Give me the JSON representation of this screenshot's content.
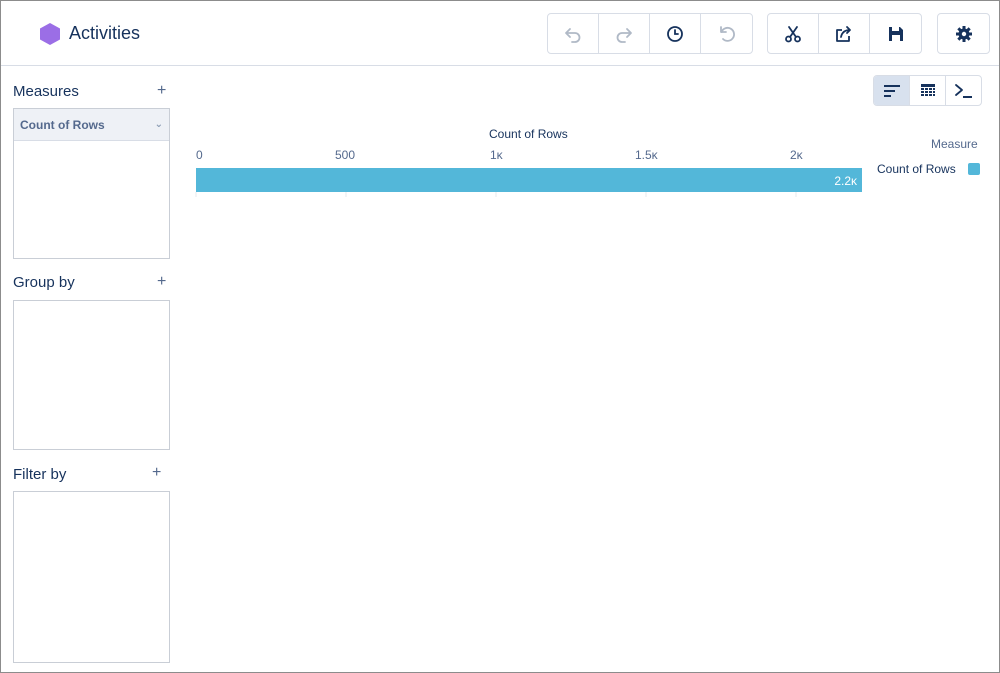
{
  "header": {
    "title": "Activities",
    "app_icon": "hexagon-icon",
    "app_icon_color": "#9b6ee6"
  },
  "toolbar": {
    "history_group": [
      "undo-icon",
      "redo-icon",
      "history-clock-icon",
      "reset-icon"
    ],
    "action_group": [
      "scissors-icon",
      "share-icon",
      "save-icon"
    ],
    "settings_group": [
      "gear-icon"
    ]
  },
  "sidebar": {
    "measures": {
      "title": "Measures",
      "add_label": "+",
      "items": [
        {
          "label": "Count of Rows"
        }
      ]
    },
    "group_by": {
      "title": "Group by",
      "add_label": "+"
    },
    "filter_by": {
      "title": "Filter by",
      "add_label": "+"
    }
  },
  "view_toggle": {
    "items": [
      "bar-chart-icon",
      "table-icon",
      "query-console-icon"
    ],
    "active": "bar-chart-icon"
  },
  "colors": {
    "bar": "#53b7d9",
    "text": "#16325c",
    "muted": "#54698d",
    "border": "#d8dde6"
  },
  "chart_data": {
    "type": "bar",
    "orientation": "horizontal",
    "title": "",
    "xlabel": "Count of Rows",
    "xlim": [
      0,
      2220
    ],
    "x_ticks": [
      "0",
      "500",
      "1κ",
      "1.5κ",
      "2κ"
    ],
    "x_tick_values": [
      0,
      500,
      1000,
      1500,
      2000
    ],
    "categories": [
      ""
    ],
    "series": [
      {
        "name": "Count of Rows",
        "values": [
          2220
        ],
        "data_labels": [
          "2.2κ"
        ]
      }
    ],
    "legend": {
      "title": "Measure",
      "placement": "right"
    }
  }
}
